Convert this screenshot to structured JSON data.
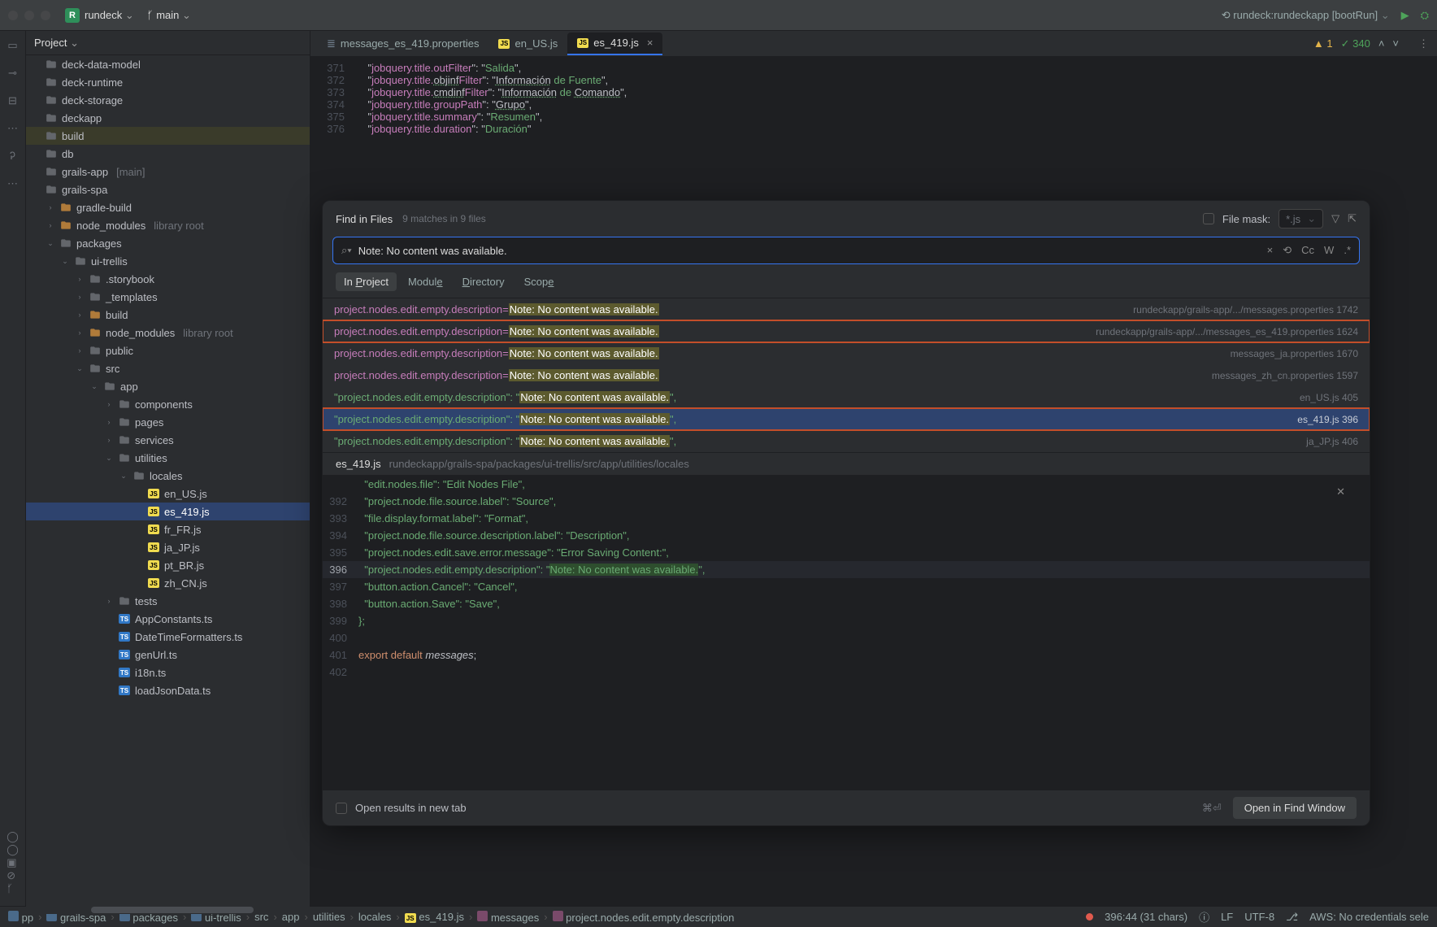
{
  "titlebar": {
    "project_initial": "R",
    "project_name": "rundeck",
    "branch": "main",
    "run_config": "rundeck:rundeckapp [bootRun]"
  },
  "sidebar": {
    "header": "Project",
    "items": [
      {
        "indent": 0,
        "kind": "dir",
        "label": "deck-data-model"
      },
      {
        "indent": 0,
        "kind": "dir",
        "label": "deck-runtime"
      },
      {
        "indent": 0,
        "kind": "dir",
        "label": "deck-storage"
      },
      {
        "indent": 0,
        "kind": "dir",
        "label": "deckapp"
      },
      {
        "indent": 0,
        "kind": "dir",
        "label": "build",
        "mark": true
      },
      {
        "indent": 0,
        "kind": "dir",
        "label": "db"
      },
      {
        "indent": 0,
        "kind": "dir",
        "label": "grails-app",
        "lbl2": "[main]"
      },
      {
        "indent": 0,
        "kind": "dir",
        "label": "grails-spa"
      },
      {
        "indent": 1,
        "kind": "dir",
        "label": "gradle-build",
        "orange": true,
        "arrow": "›"
      },
      {
        "indent": 1,
        "kind": "dir",
        "label": "node_modules",
        "orange": true,
        "lbl2": "library root",
        "arrow": "›"
      },
      {
        "indent": 1,
        "kind": "dir",
        "label": "packages",
        "arrow": "⌄"
      },
      {
        "indent": 2,
        "kind": "dir",
        "label": "ui-trellis",
        "arrow": "⌄"
      },
      {
        "indent": 3,
        "kind": "dir",
        "label": ".storybook",
        "arrow": "›"
      },
      {
        "indent": 3,
        "kind": "dir",
        "label": "_templates",
        "arrow": "›"
      },
      {
        "indent": 3,
        "kind": "dir",
        "label": "build",
        "orange": true,
        "arrow": "›"
      },
      {
        "indent": 3,
        "kind": "dir",
        "label": "node_modules",
        "orange": true,
        "lbl2": "library root",
        "arrow": "›"
      },
      {
        "indent": 3,
        "kind": "dir",
        "label": "public",
        "arrow": "›"
      },
      {
        "indent": 3,
        "kind": "dir",
        "label": "src",
        "arrow": "⌄"
      },
      {
        "indent": 4,
        "kind": "dir",
        "label": "app",
        "arrow": "⌄"
      },
      {
        "indent": 5,
        "kind": "dir",
        "label": "components",
        "arrow": "›"
      },
      {
        "indent": 5,
        "kind": "dir",
        "label": "pages",
        "arrow": "›"
      },
      {
        "indent": 5,
        "kind": "dir",
        "label": "services",
        "arrow": "›"
      },
      {
        "indent": 5,
        "kind": "dir",
        "label": "utilities",
        "arrow": "⌄"
      },
      {
        "indent": 6,
        "kind": "dir",
        "label": "locales",
        "arrow": "⌄"
      },
      {
        "indent": 7,
        "kind": "js",
        "label": "en_US.js"
      },
      {
        "indent": 7,
        "kind": "js",
        "label": "es_419.js",
        "sel": true
      },
      {
        "indent": 7,
        "kind": "js",
        "label": "fr_FR.js"
      },
      {
        "indent": 7,
        "kind": "js",
        "label": "ja_JP.js"
      },
      {
        "indent": 7,
        "kind": "js",
        "label": "pt_BR.js"
      },
      {
        "indent": 7,
        "kind": "js",
        "label": "zh_CN.js"
      },
      {
        "indent": 5,
        "kind": "dir",
        "label": "tests",
        "arrow": "›"
      },
      {
        "indent": 5,
        "kind": "ts",
        "label": "AppConstants.ts"
      },
      {
        "indent": 5,
        "kind": "ts",
        "label": "DateTimeFormatters.ts"
      },
      {
        "indent": 5,
        "kind": "ts",
        "label": "genUrl.ts"
      },
      {
        "indent": 5,
        "kind": "ts",
        "label": "i18n.ts"
      },
      {
        "indent": 5,
        "kind": "ts",
        "label": "loadJsonData.ts"
      }
    ]
  },
  "tabs": [
    {
      "icon": "props",
      "label": "messages_es_419.properties"
    },
    {
      "icon": "js",
      "label": "en_US.js"
    },
    {
      "icon": "js",
      "label": "es_419.js",
      "active": true,
      "close": true
    }
  ],
  "inspection": {
    "warn_count": "1",
    "check_count": "340"
  },
  "editor_lines": [
    {
      "n": "371",
      "parts": [
        [
          "pun",
          "    \""
        ],
        [
          "key",
          "jobquery"
        ],
        [
          "key",
          ".title.outFilter"
        ],
        [
          "pun",
          "\": \""
        ],
        [
          "str",
          "Salida"
        ],
        [
          "pun",
          "\","
        ]
      ]
    },
    {
      "n": "372",
      "parts": [
        [
          "pun",
          "    \""
        ],
        [
          "key",
          "jobquery"
        ],
        [
          "key",
          ".title."
        ],
        [
          "und",
          "objinf"
        ],
        [
          "key",
          "Filter"
        ],
        [
          "pun",
          "\": \""
        ],
        [
          "und",
          "Información"
        ],
        [
          "str",
          " de Fuente"
        ],
        [
          "pun",
          "\","
        ]
      ]
    },
    {
      "n": "373",
      "parts": [
        [
          "pun",
          "    \""
        ],
        [
          "key",
          "jobquery"
        ],
        [
          "key",
          ".title."
        ],
        [
          "und",
          "cmdinf"
        ],
        [
          "key",
          "Filter"
        ],
        [
          "pun",
          "\": \""
        ],
        [
          "und",
          "Información"
        ],
        [
          "str",
          " de "
        ],
        [
          "und",
          "Comando"
        ],
        [
          "pun",
          "\","
        ]
      ]
    },
    {
      "n": "374",
      "parts": [
        [
          "pun",
          "    \""
        ],
        [
          "key",
          "jobquery"
        ],
        [
          "key",
          ".title.groupPath"
        ],
        [
          "pun",
          "\": \""
        ],
        [
          "und",
          "Grupo"
        ],
        [
          "pun",
          "\","
        ]
      ]
    },
    {
      "n": "375",
      "parts": [
        [
          "pun",
          "    \""
        ],
        [
          "key",
          "jobquery"
        ],
        [
          "key",
          ".title.summary"
        ],
        [
          "pun",
          "\": \""
        ],
        [
          "str",
          "Resumen"
        ],
        [
          "pun",
          "\","
        ]
      ]
    },
    {
      "n": "376",
      "parts": [
        [
          "pun",
          "    \""
        ],
        [
          "key",
          "jobquery"
        ],
        [
          "key",
          ".title.duration"
        ],
        [
          "pun",
          "\": \""
        ],
        [
          "str",
          "Duración"
        ],
        [
          "pun",
          "\""
        ]
      ]
    }
  ],
  "modal": {
    "title": "Find in Files",
    "summary": "9 matches in 9 files",
    "file_mask_label": "File mask:",
    "file_mask_value": "*.js",
    "search_value": "Note: No content was available.",
    "scopes": [
      "In Project",
      "Module",
      "Directory",
      "Scope"
    ],
    "scope_active": 0,
    "search_tools": {
      "cc": "Cc",
      "w": "W",
      "rx": ".*"
    },
    "preview_file": "es_419.js",
    "preview_path": "rundeckapp/grails-spa/packages/ui-trellis/src/app/utilities/locales",
    "open_new_tab": "Open results in new tab",
    "kb_hint": "⌘⏎",
    "open_button": "Open in Find Window"
  },
  "results": [
    {
      "left_key": "project.nodes.edit.empty.description=",
      "match": "Note: No content was available.",
      "path": "rundeckapp/grails-app/.../messages.properties",
      "ln": "1742"
    },
    {
      "left_key": "project.nodes.edit.empty.description=",
      "match": "Note: No content was available.",
      "path": "rundeckapp/grails-app/.../messages_es_419.properties",
      "ln": "1624",
      "box": true
    },
    {
      "left_key": "project.nodes.edit.empty.description=",
      "match": "Note: No content was available.",
      "path": "messages_ja.properties",
      "ln": "1670"
    },
    {
      "left_key": "project.nodes.edit.empty.description=",
      "match": "Note: No content was available.",
      "path": "messages_zh_cn.properties",
      "ln": "1597"
    },
    {
      "left_key_q": "\"project.nodes.edit.empty.description\": \"",
      "match": "Note: No content was available.",
      "suffix": "\",",
      "path": "en_US.js",
      "ln": "405"
    },
    {
      "left_key_q": "\"project.nodes.edit.empty.description\": \"",
      "match": "Note: No content was available.",
      "suffix": "\",",
      "path": "es_419.js",
      "ln": "396",
      "sel": true,
      "box": true
    },
    {
      "left_key_q": "\"project.nodes.edit.empty.description\": \"",
      "match": "Note: No content was available.",
      "suffix": "\",",
      "path": "ja_JP.js",
      "ln": "406"
    }
  ],
  "preview_lines": [
    {
      "n": "",
      "code": "  \"edit.nodes.file\": \"Edit Nodes File\","
    },
    {
      "n": "392",
      "code": "  \"project.node.file.source.label\": \"Source\","
    },
    {
      "n": "393",
      "code": "  \"file.display.format.label\": \"Format\","
    },
    {
      "n": "394",
      "code": "  \"project.node.file.source.description.label\": \"Description\","
    },
    {
      "n": "395",
      "code": "  \"project.nodes.edit.save.error.message\": \"Error Saving Content:\","
    },
    {
      "n": "396",
      "code": "  \"project.nodes.edit.empty.description\": \"",
      "hl": "Note: No content was available.",
      "tail": "\",",
      "cur": true
    },
    {
      "n": "397",
      "code": "  \"button.action.Cancel\": \"Cancel\","
    },
    {
      "n": "398",
      "code": "  \"button.action.Save\": \"Save\","
    },
    {
      "n": "399",
      "code": "};"
    },
    {
      "n": "400",
      "code": ""
    },
    {
      "n": "401",
      "code_parts": [
        [
          "kw",
          "export "
        ],
        [
          "kw",
          "default "
        ],
        [
          "id",
          "messages"
        ],
        [
          "pun",
          ";"
        ]
      ]
    },
    {
      "n": "402",
      "code": ""
    }
  ],
  "status": {
    "breadcrumbs": [
      "pp",
      "grails-spa",
      "packages",
      "ui-trellis",
      "src",
      "app",
      "utilities",
      "locales",
      "es_419.js",
      "messages",
      "project.nodes.edit.empty.description"
    ],
    "pos": "396:44 (31 chars)",
    "indent": "ⓘ",
    "line_sep": "LF",
    "encoding": "UTF-8",
    "aws": "AWS: No credentials sele"
  }
}
